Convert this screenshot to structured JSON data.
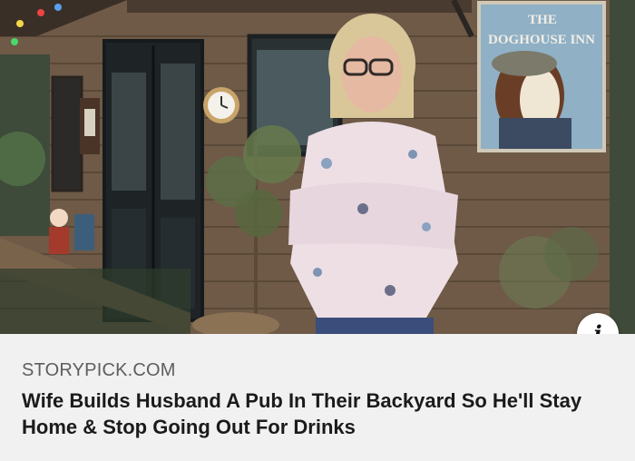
{
  "photo": {
    "sign": {
      "line1": "THE",
      "line2": "DOGHOUSE INN"
    }
  },
  "info_button": {
    "icon": "info-icon",
    "glyph": "i"
  },
  "caption": {
    "source": "STORYPICK.COM",
    "headline": "Wife Builds Husband A Pub In Their Backyard So He'll Stay Home & Stop Going Out For Drinks"
  },
  "colors": {
    "caption_background": "#f1f1f1",
    "source_text": "#5e5e5e",
    "headline_text": "#1b1b1b"
  }
}
